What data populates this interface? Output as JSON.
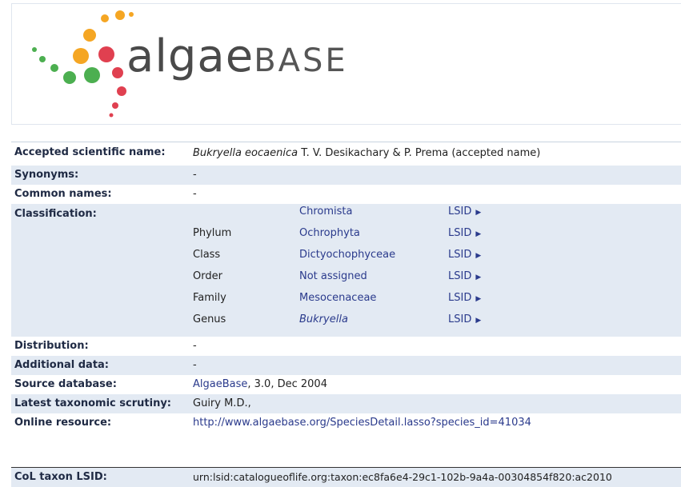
{
  "logo": {
    "word1": "algae",
    "word2": "BASE"
  },
  "fields": {
    "accepted": {
      "label": "Accepted scientific name:",
      "genus_species": "Bukryella eocaenica",
      "authority": "T. V. Desikachary & P. Prema (accepted name)"
    },
    "synonyms": {
      "label": "Synonyms:",
      "value": "-"
    },
    "common": {
      "label": "Common names:",
      "value": "-"
    },
    "classification": {
      "label": "Classification:",
      "rows": [
        {
          "rank": "",
          "name": "Chromista",
          "lsid": "LSID"
        },
        {
          "rank": "Phylum",
          "name": "Ochrophyta",
          "lsid": "LSID"
        },
        {
          "rank": "Class",
          "name": "Dictyochophyceae",
          "lsid": "LSID"
        },
        {
          "rank": "Order",
          "name": "Not assigned",
          "lsid": "LSID"
        },
        {
          "rank": "Family",
          "name": "Mesocenaceae",
          "lsid": "LSID"
        },
        {
          "rank": "Genus",
          "name": "Bukryella",
          "lsid": "LSID"
        }
      ]
    },
    "distribution": {
      "label": "Distribution:",
      "value": "-"
    },
    "additional": {
      "label": "Additional data:",
      "value": "-"
    },
    "source": {
      "label": "Source database:",
      "link": "AlgaeBase",
      "rest": ", 3.0, Dec 2004"
    },
    "scrutiny": {
      "label": "Latest taxonomic scrutiny:",
      "value": "Guiry M.D.,"
    },
    "online": {
      "label": "Online resource:",
      "value": "http://www.algaebase.org/SpeciesDetail.lasso?species_id=41034"
    },
    "col_lsid": {
      "label": "CoL taxon LSID:",
      "value": "urn:lsid:catalogueoflife.org:taxon:ec8fa6e4-29c1-102b-9a4a-00304854f820:ac2010"
    }
  },
  "colors": {
    "row_blue": "#e3eaf3",
    "link": "#2a3a8c",
    "label": "#1f2a44"
  }
}
